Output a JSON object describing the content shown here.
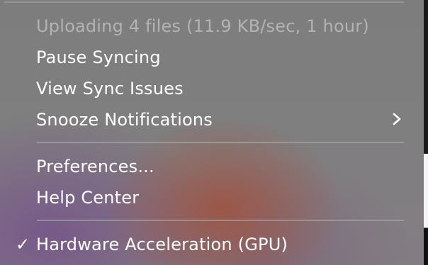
{
  "menu": {
    "status": "Uploading 4 files (11.9 KB/sec, 1 hour)",
    "items": [
      {
        "label": "Pause Syncing"
      },
      {
        "label": "View Sync Issues"
      },
      {
        "label": "Snooze Notifications",
        "submenu_icon": "chevron-right-icon"
      },
      {
        "label": "Preferences..."
      },
      {
        "label": "Help Center"
      },
      {
        "label": "Hardware Acceleration (GPU)",
        "checked": true,
        "check_mark": "✓"
      }
    ]
  }
}
